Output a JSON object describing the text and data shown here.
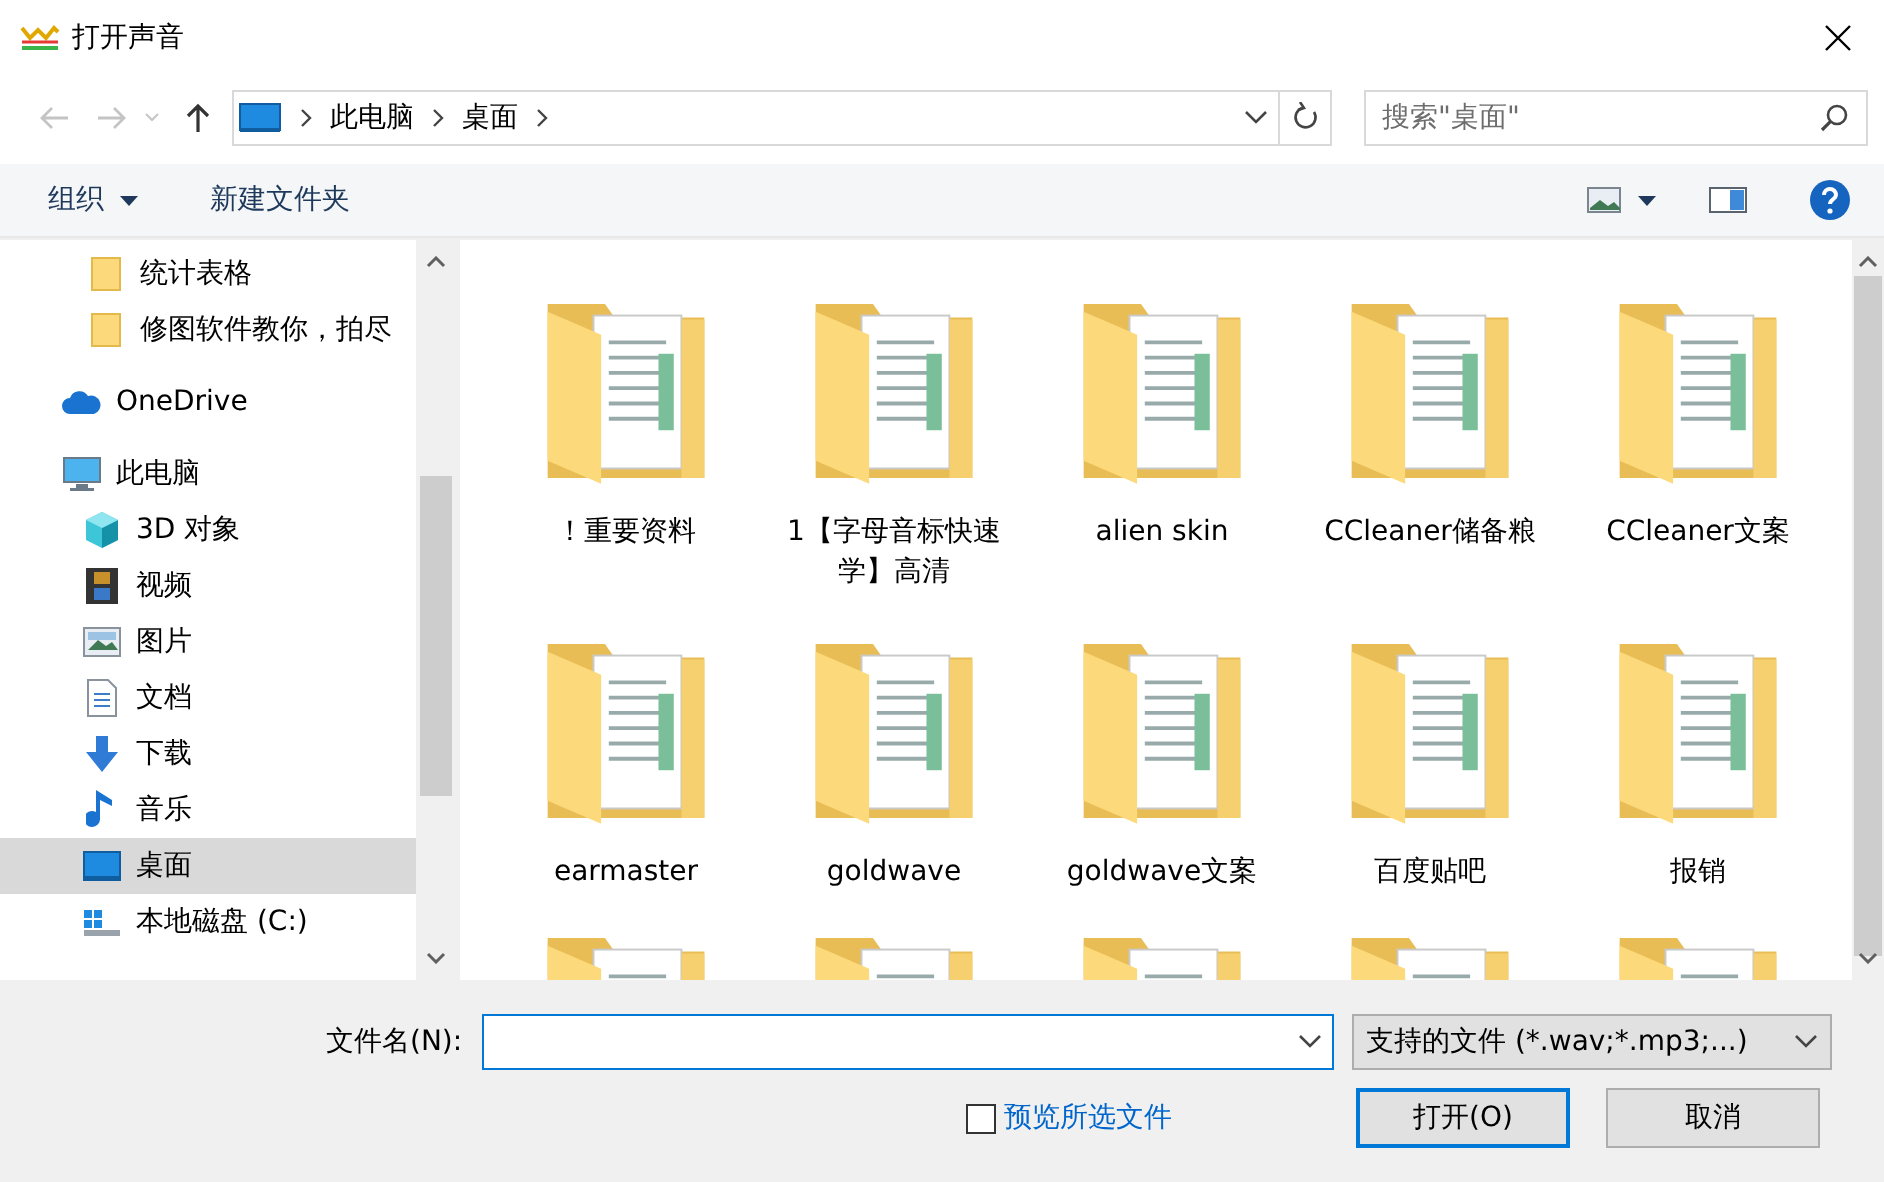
{
  "window": {
    "title": "打开声音"
  },
  "address": {
    "path": [
      "此电脑",
      "桌面"
    ],
    "search_placeholder": "搜索\"桌面\""
  },
  "toolbar": {
    "organize": "组织",
    "new_folder": "新建文件夹"
  },
  "nav": [
    {
      "label": "统计表格",
      "kind": "folder",
      "selected": false
    },
    {
      "label": "修图软件教你，拍尽",
      "kind": "folder",
      "selected": false
    },
    {
      "label": "OneDrive",
      "kind": "cloud",
      "selected": false
    },
    {
      "label": "此电脑",
      "kind": "pc",
      "selected": false,
      "children": [
        {
          "label": "3D 对象",
          "kind": "cube",
          "selected": false
        },
        {
          "label": "视频",
          "kind": "film",
          "selected": false
        },
        {
          "label": "图片",
          "kind": "picture",
          "selected": false
        },
        {
          "label": "文档",
          "kind": "document",
          "selected": false
        },
        {
          "label": "下载",
          "kind": "download",
          "selected": false
        },
        {
          "label": "音乐",
          "kind": "music",
          "selected": false
        },
        {
          "label": "桌面",
          "kind": "desktop",
          "selected": true
        },
        {
          "label": "本地磁盘 (C:)",
          "kind": "drive",
          "selected": false
        }
      ]
    }
  ],
  "files": [
    {
      "name": "！重要资料"
    },
    {
      "name": "1【字母音标快速学】高清"
    },
    {
      "name": "alien skin"
    },
    {
      "name": "CCleaner储备粮"
    },
    {
      "name": "CCleaner文案"
    },
    {
      "name": "earmaster"
    },
    {
      "name": "goldwave"
    },
    {
      "name": "goldwave文案"
    },
    {
      "name": "百度贴吧"
    },
    {
      "name": "报销"
    }
  ],
  "footer": {
    "filename_label": "文件名(N):",
    "filetype": "支持的文件 (*.wav;*.mp3;...)",
    "preview": {
      "label": "预览所选文件",
      "checked": false
    },
    "buttons": [
      {
        "label": "打开(O)",
        "default": true
      },
      {
        "label": "取消",
        "default": false
      }
    ]
  }
}
